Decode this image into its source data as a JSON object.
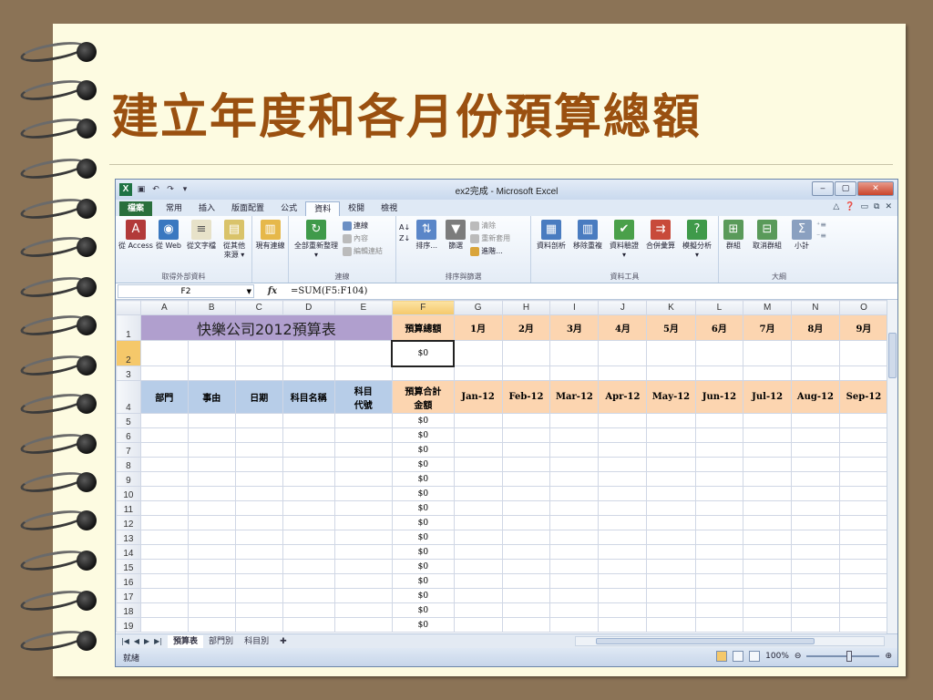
{
  "slide": {
    "title": "建立年度和各月份預算總額"
  },
  "window": {
    "title": "ex2完成 - Microsoft Excel",
    "minimize": "‒",
    "restore": "▢",
    "close": "✕"
  },
  "tabs": [
    "檔案",
    "常用",
    "插入",
    "版面配置",
    "公式",
    "資料",
    "校閱",
    "檢視"
  ],
  "ribbon": {
    "groups": {
      "get_external": "取得外部資料",
      "connections": "連線",
      "sort_filter": "排序與篩選",
      "data_tools": "資料工具",
      "outline": "大綱"
    },
    "buttons": {
      "from_access": "從 Access",
      "from_web": "從 Web",
      "from_text": "從文字檔",
      "from_other_1": "從其他",
      "from_other_2": "來源 ▾",
      "existing_conn": "現有連線",
      "refresh_all": "全部重新整理",
      "refresh_caret": "▾",
      "conn_link": "連線",
      "properties": "內容",
      "edit_links": "編輯連結",
      "sort_asc": "A↓",
      "sort_desc": "Z↓",
      "sort": "排序...",
      "filter": "篩選",
      "clear": "清除",
      "reapply": "重新套用",
      "advanced": "進階...",
      "text_to_cols": "資料剖析",
      "remove_dups": "移除重複",
      "validation": "資料驗證",
      "validation_caret": "▾",
      "consolidate": "合併彙算",
      "what_if": "模擬分析",
      "what_if_caret": "▾",
      "group": "群組",
      "ungroup": "取消群組",
      "subtotal": "小計"
    }
  },
  "formula_bar": {
    "name_box": "F2",
    "fx": "fx",
    "formula": "=SUM(F5:F104)"
  },
  "columns": [
    "A",
    "B",
    "C",
    "D",
    "E",
    "F",
    "G",
    "H",
    "I",
    "J",
    "K",
    "L",
    "M",
    "N",
    "O"
  ],
  "row1": {
    "banner": "快樂公司2012預算表",
    "total_label": "預算總額",
    "months": [
      "1月",
      "2月",
      "3月",
      "4月",
      "5月",
      "6月",
      "7月",
      "8月",
      "9月"
    ]
  },
  "row2": {
    "total_value": "$0"
  },
  "row4": {
    "headers": [
      "部門",
      "事由",
      "日期",
      "科目名稱"
    ],
    "code_header_1": "科目",
    "code_header_2": "代號",
    "amount_header_1": "預算合計",
    "amount_header_2": "金額",
    "months": [
      "Jan-12",
      "Feb-12",
      "Mar-12",
      "Apr-12",
      "May-12",
      "Jun-12",
      "Jul-12",
      "Aug-12",
      "Sep-12"
    ]
  },
  "data_rows": [
    {
      "row": "5",
      "amount": "$0"
    },
    {
      "row": "6",
      "amount": "$0"
    },
    {
      "row": "7",
      "amount": "$0"
    },
    {
      "row": "8",
      "amount": "$0"
    },
    {
      "row": "9",
      "amount": "$0"
    },
    {
      "row": "10",
      "amount": "$0"
    },
    {
      "row": "11",
      "amount": "$0"
    },
    {
      "row": "12",
      "amount": "$0"
    },
    {
      "row": "13",
      "amount": "$0"
    },
    {
      "row": "14",
      "amount": "$0"
    },
    {
      "row": "15",
      "amount": "$0"
    },
    {
      "row": "16",
      "amount": "$0"
    },
    {
      "row": "17",
      "amount": "$0"
    },
    {
      "row": "18",
      "amount": "$0"
    },
    {
      "row": "19",
      "amount": "$0"
    }
  ],
  "sheets": [
    "預算表",
    "部門別",
    "科目別"
  ],
  "status": {
    "ready": "就緒",
    "zoom": "100%"
  },
  "colors": {
    "banner": "#b09fce",
    "header_orange": "#fcd5b0",
    "header_blue": "#b7cde8",
    "title": "#9a5010"
  }
}
